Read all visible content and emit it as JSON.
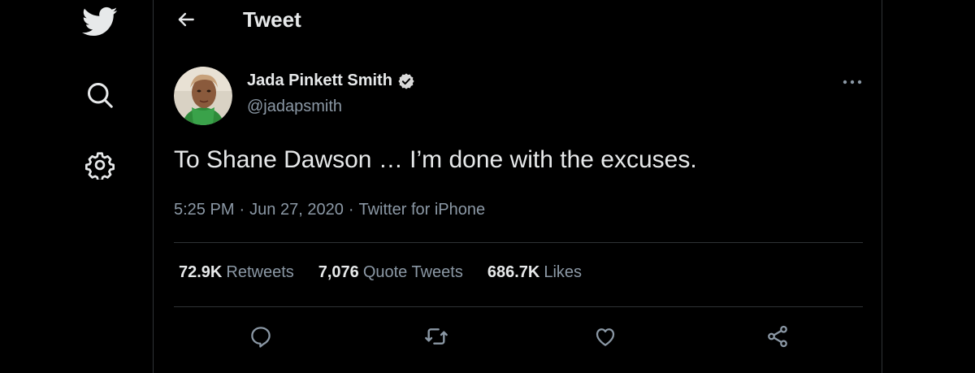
{
  "nav": {
    "logo_icon": "twitter-bird-icon",
    "items": [
      {
        "name": "search",
        "icon": "search-icon"
      },
      {
        "name": "settings",
        "icon": "gear-icon"
      }
    ]
  },
  "header": {
    "back_icon": "arrow-left-icon",
    "title": "Tweet"
  },
  "author": {
    "display_name": "Jada Pinkett Smith",
    "handle": "@jadapsmith",
    "verified_icon": "verified-badge-icon"
  },
  "tweet": {
    "text": "To Shane Dawson … I’m done with the excuses.",
    "time": "5:25 PM",
    "date": "Jun 27, 2020",
    "source": "Twitter for iPhone",
    "separator": "·"
  },
  "stats": {
    "retweets_count": "72.9K",
    "retweets_label": "Retweets",
    "quotes_count": "7,076",
    "quotes_label": "Quote Tweets",
    "likes_count": "686.7K",
    "likes_label": "Likes"
  },
  "actions": [
    "reply-icon",
    "retweet-icon",
    "like-icon",
    "share-icon"
  ],
  "colors": {
    "background": "#000000",
    "text_primary": "#e7e9ea",
    "text_secondary": "#8b98a5",
    "border": "#2f3336"
  }
}
